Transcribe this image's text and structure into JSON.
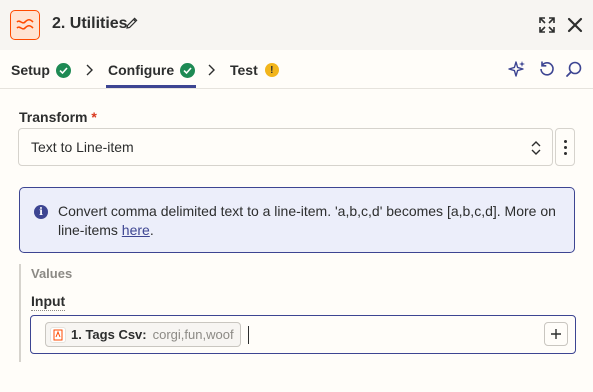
{
  "header": {
    "title": "2. Utilities",
    "app_icon": "utilities-icon",
    "brand_color": "#ff4a00"
  },
  "steps": [
    {
      "label": "Setup",
      "status": "complete"
    },
    {
      "label": "Configure",
      "status": "complete",
      "active": true
    },
    {
      "label": "Test",
      "status": "warning",
      "badge": "!"
    }
  ],
  "transform": {
    "label": "Transform",
    "required_marker": "*",
    "value": "Text to Line-item"
  },
  "info": {
    "text": "Convert comma delimited text to a line-item. 'a,b,c,d' becomes [a,b,c,d]. More on line-items ",
    "link_text": "here",
    "suffix": ".",
    "icon_glyph": "i"
  },
  "values": {
    "section_label": "Values",
    "input_label": "Input",
    "pill_key": "1. Tags Csv:",
    "pill_value": "corgi,fun,woof"
  },
  "colors": {
    "accent": "#3d4592",
    "success": "#1e8a54",
    "warning": "#f2b51c"
  }
}
